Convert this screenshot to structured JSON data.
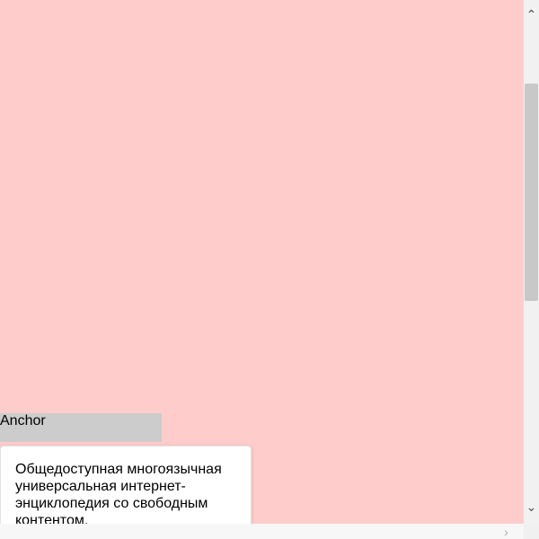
{
  "page": {
    "background_color": "#ffcccc"
  },
  "anchor": {
    "label": "Anchor",
    "background_color": "#cccccc"
  },
  "popover": {
    "text": "Общедоступная многоязычная универсальная интернет-энциклопедия со свободным контентом."
  },
  "scrollbars": {
    "up_arrow": "⌃",
    "down_arrow": "⌄",
    "right_arrow": "›"
  },
  "icons": {
    "scroll_up": "chevron-up-icon",
    "scroll_down": "chevron-down-icon",
    "scroll_right": "chevron-right-icon"
  }
}
